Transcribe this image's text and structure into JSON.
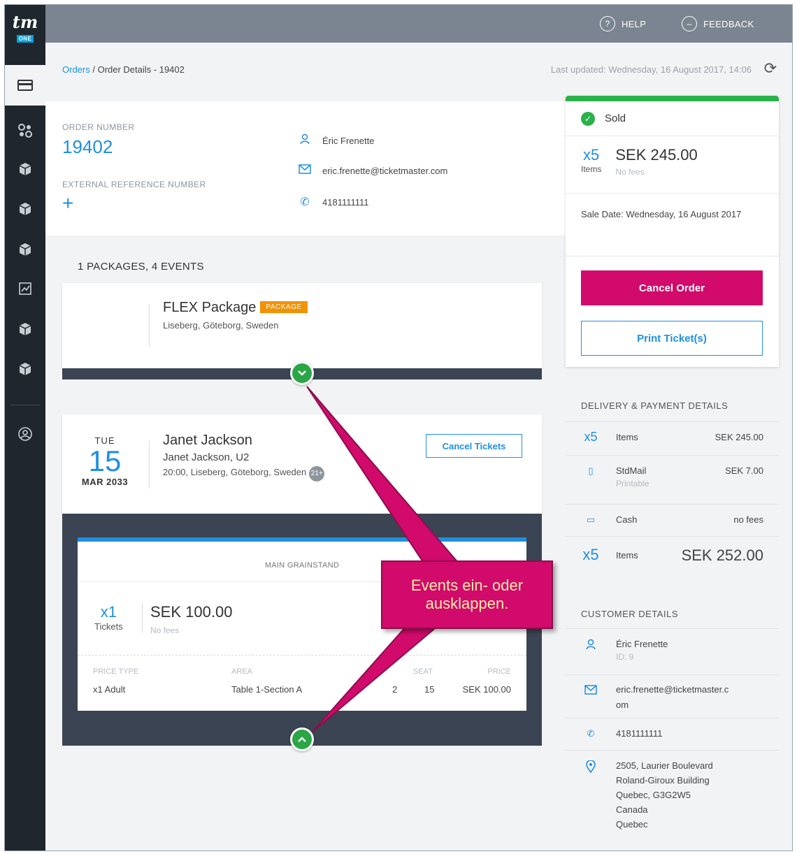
{
  "app": {
    "logo_text": "tm",
    "logo_sub": "ONE"
  },
  "topbar": {
    "help": "HELP",
    "feedback": "FEEDBACK"
  },
  "breadcrumb": {
    "root": "Orders",
    "separator": " / ",
    "current": "Order Details - 19402"
  },
  "last_updated": "Last updated: Wednesday, 16 August 2017, 14:06",
  "order": {
    "number_label": "ORDER NUMBER",
    "number": "19402",
    "ext_ref_label": "EXTERNAL REFERENCE NUMBER",
    "ext_ref_add": "+",
    "customer_name": "Éric Frenette",
    "email": "eric.frenette@ticketmaster.com",
    "phone": "4181111111"
  },
  "summary": {
    "status": "Sold",
    "qty": "x5",
    "qty_unit": "Items",
    "total": "SEK 245.00",
    "fees": "No fees",
    "sale_date_label": "Sale Date:",
    "sale_date": "Wednesday, 16 August 2017",
    "cancel_order": "Cancel Order",
    "print_tickets": "Print Ticket(s)"
  },
  "delivery": {
    "title": "DELIVERY & PAYMENT DETAILS",
    "items_qty": "x5",
    "items_label": "Items",
    "items_amount": "SEK 245.00",
    "shipping_label": "StdMail",
    "shipping_sub": "Printable",
    "shipping_amount": "SEK 7.00",
    "payment_label": "Cash",
    "payment_amount": "no fees",
    "total_qty": "x5",
    "total_label": "Items",
    "total_amount": "SEK 252.00"
  },
  "customer": {
    "title": "CUSTOMER DETAILS",
    "name": "Éric Frenette",
    "id": "ID: 9",
    "email_line1": "eric.frenette@ticketmaster.c",
    "email_line2": "om",
    "phone": "4181111111",
    "address": [
      "2505, Laurier Boulevard",
      "Roland-Giroux Building",
      "Quebec, G3G2W5",
      "Canada",
      "Quebec"
    ]
  },
  "packages": {
    "count_text": "1 PACKAGES,  4 EVENTS",
    "package_name": "FLEX Package",
    "package_badge": "PACKAGE",
    "package_location": "Liseberg, Göteborg, Sweden"
  },
  "event": {
    "dow": "TUE",
    "day": "15",
    "month_year": "MAR 2033",
    "name": "Janet Jackson",
    "subtitle": "Janet Jackson, U2",
    "details": "20:00, Liseberg, Göteborg, Sweden",
    "age_badge": "21+",
    "cancel_tickets": "Cancel Tickets"
  },
  "ticket": {
    "section": "MAIN GRAINSTAND",
    "qty": "x1",
    "qty_unit": "Tickets",
    "amount": "SEK 100.00",
    "fees": "No fees",
    "headers": {
      "price_type": "PRICE TYPE",
      "area": "AREA",
      "seat": "SEAT",
      "price": "PRICE"
    },
    "row": {
      "price_type": "x1 Adult",
      "area": "Table 1-Section A",
      "row": "2",
      "seat": "15",
      "price": "SEK 100.00"
    }
  },
  "callout": {
    "line1": "Events ein- oder",
    "line2": "ausklappen."
  },
  "icons": {
    "help": "question-circle-icon",
    "feedback": "chat-bubble-icon",
    "refresh": "refresh-icon"
  },
  "colors": {
    "accent": "#1f8fe0",
    "success": "#2bb14a",
    "danger": "#d10a6b",
    "badge": "#f39200",
    "sidebar": "#1f262d",
    "topbar": "#7a8591"
  }
}
